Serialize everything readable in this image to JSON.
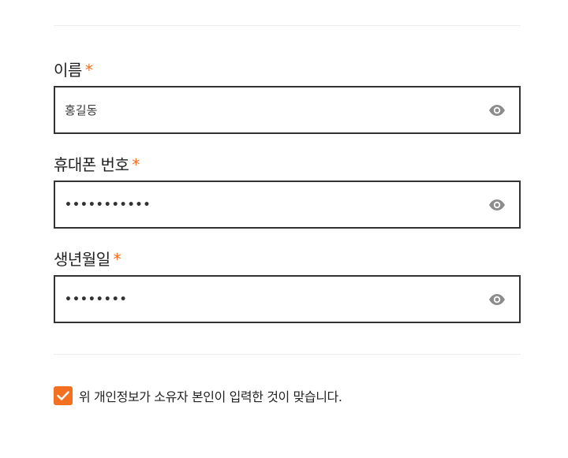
{
  "form": {
    "fields": [
      {
        "label": "이름",
        "required_mark": "*",
        "value": "홍길동",
        "masked": false,
        "icon": "eye-icon"
      },
      {
        "label": "휴대폰 번호",
        "required_mark": "*",
        "value": "•••••••••••",
        "masked": true,
        "icon": "eye-icon"
      },
      {
        "label": "생년월일",
        "required_mark": "*",
        "value": "••••••••",
        "masked": true,
        "icon": "eye-icon"
      }
    ],
    "consent": {
      "checked": true,
      "text": "위 개인정보가 소유자 본인이 입력한 것이 맞습니다."
    }
  },
  "colors": {
    "accent": "#f37021",
    "border": "#333333",
    "divider": "#ececec"
  }
}
